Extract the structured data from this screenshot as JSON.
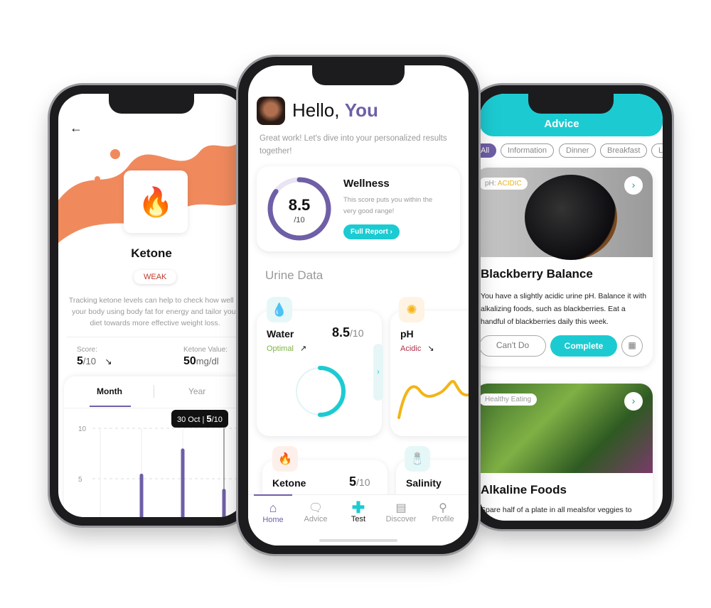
{
  "left": {
    "title": "Ketone",
    "badge": "WEAK",
    "description": "Tracking ketone levels can help to check how well is your body using body fat for energy and tailor your diet towards more effective weight loss.",
    "score_label": "Score:",
    "score_value": "5",
    "score_max": "/10",
    "ketone_label": "Ketone Value:",
    "ketone_value": "50",
    "ketone_unit": "mg/dl",
    "tabs": [
      "Month",
      "Year"
    ],
    "tooltip_date": "30 Oct | ",
    "tooltip_value": "5",
    "tooltip_max": "/10",
    "chart_data": {
      "type": "bar",
      "yticks": [
        "10",
        "5"
      ],
      "ylim": [
        0,
        10
      ],
      "values": [
        1,
        5.5,
        8,
        4
      ],
      "color": "#6f5fa6"
    }
  },
  "center": {
    "greeting": "Hello, ",
    "name": "You",
    "subtitle": "Great work! Let's dive into your personalized results together!",
    "wellness": {
      "score": "8.5",
      "max": "/10",
      "progress": 0.85,
      "title": "Wellness",
      "text": "This score puts you within the very good range!",
      "button": "Full Report ›"
    },
    "section_title": "Urine Data",
    "cards": [
      {
        "title": "Water",
        "value": "8.5",
        "max": "/10",
        "status": "Optimal",
        "status_color": "#7cb342",
        "trend": "↗",
        "progress": 0.5
      },
      {
        "title": "pH",
        "status": "Acidic",
        "status_color": "#b0304a",
        "trend": "↘"
      },
      {
        "title": "Ketone",
        "value": "5",
        "max": "/10"
      },
      {
        "title": "Salinity"
      }
    ],
    "nav": [
      {
        "label": "Home",
        "icon": "home-icon",
        "active": true
      },
      {
        "label": "Advice",
        "icon": "chat-icon"
      },
      {
        "label": "Test",
        "icon": "plus-icon"
      },
      {
        "label": "Discover",
        "icon": "notebook-icon"
      },
      {
        "label": "Profile",
        "icon": "person-icon"
      }
    ]
  },
  "right": {
    "header": "Advice",
    "chips": [
      "All",
      "Information",
      "Dinner",
      "Breakfast",
      "L"
    ],
    "card1": {
      "tag_label": "pH: ",
      "tag_value": "ACIDIC",
      "title": "Blackberry Balance",
      "text": "You have a slightly acidic urine pH. Balance it with alkalizing foods, such as blackberries. Eat a handful of blackberries daily this week.",
      "cant": "Can't Do",
      "complete": "Complete"
    },
    "card2": {
      "tag": "Healthy Eating",
      "title": "Alkaline Foods",
      "text": "Spare half of a plate in all mealsfor veggies to"
    }
  },
  "colors": {
    "purple": "#6f5fa6",
    "teal": "#1ccbd2",
    "orange": "#f08a5d"
  }
}
